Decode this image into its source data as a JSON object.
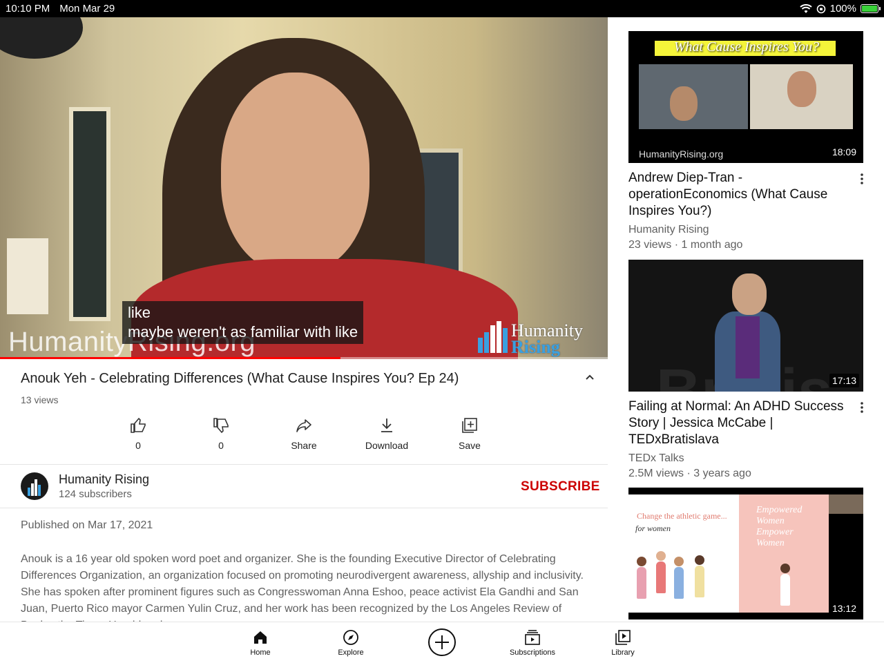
{
  "status_bar": {
    "time": "10:10 PM",
    "date": "Mon Mar 29",
    "battery": "100%"
  },
  "player": {
    "captions": [
      "like",
      "maybe weren't as familiar with like"
    ],
    "watermark": "HumanityRising.org",
    "logo_text_line1": "Humanity",
    "logo_text_line2": "Rising",
    "progress_fraction": 0.56
  },
  "video": {
    "title": "Anouk Yeh - Celebrating Differences (What Cause Inspires You? Ep 24)",
    "views": "13 views"
  },
  "actions": [
    {
      "label": "0",
      "icon": "thumbs-up-icon"
    },
    {
      "label": "0",
      "icon": "thumbs-down-icon"
    },
    {
      "label": "Share",
      "icon": "share-icon"
    },
    {
      "label": "Download",
      "icon": "download-icon"
    },
    {
      "label": "Save",
      "icon": "save-to-playlist-icon"
    }
  ],
  "channel": {
    "name": "Humanity Rising",
    "subscribers": "124 subscribers",
    "subscribe_label": "SUBSCRIBE"
  },
  "description": {
    "published": "Published on Mar 17, 2021",
    "text": "Anouk is a 16 year old spoken word poet and organizer. She is the founding Executive Director of Celebrating Differences Organization, an organization focused on promoting neurodivergent awareness, allyship and inclusivity. She has spoken after prominent figures such as Congresswoman Anna Eshoo, peace activist Ela Gandhi and San Juan, Puerto Rico mayor Carmen Yulin Cruz, and her work has been recognized by the Los Angeles Review of Books, the Times Herald and"
  },
  "recommended": [
    {
      "title": "Andrew Diep-Tran - operationEconomics (What Cause Inspires You?)",
      "channel": "Humanity Rising",
      "meta": "23 views · 1 month ago",
      "duration": "18:09",
      "thumb_banner": "What Cause Inspires You?",
      "thumb_site": "HumanityRising.org"
    },
    {
      "title": "Failing at Normal: An ADHD Success Story | Jessica McCabe | TEDxBratislava",
      "channel": "TEDx Talks",
      "meta": "2.5M views · 3 years ago",
      "duration": "17:13",
      "thumb_text": "Bratis"
    },
    {
      "title": "",
      "channel": "",
      "meta": "",
      "duration": "13:12",
      "thumb_hand1": "Change the athletic game...",
      "thumb_hand2": "for women",
      "thumb_hand3": "Empowered Women Empower Women"
    }
  ],
  "tabs": [
    {
      "label": "Home",
      "icon": "home-icon"
    },
    {
      "label": "Explore",
      "icon": "explore-compass-icon"
    },
    {
      "label": "Subscriptions",
      "icon": "subscriptions-icon"
    },
    {
      "label": "Library",
      "icon": "library-icon"
    }
  ],
  "colors": {
    "subscribe": "#cc0000",
    "progress": "#ff0000",
    "brand_blue": "#3aa0e0"
  }
}
